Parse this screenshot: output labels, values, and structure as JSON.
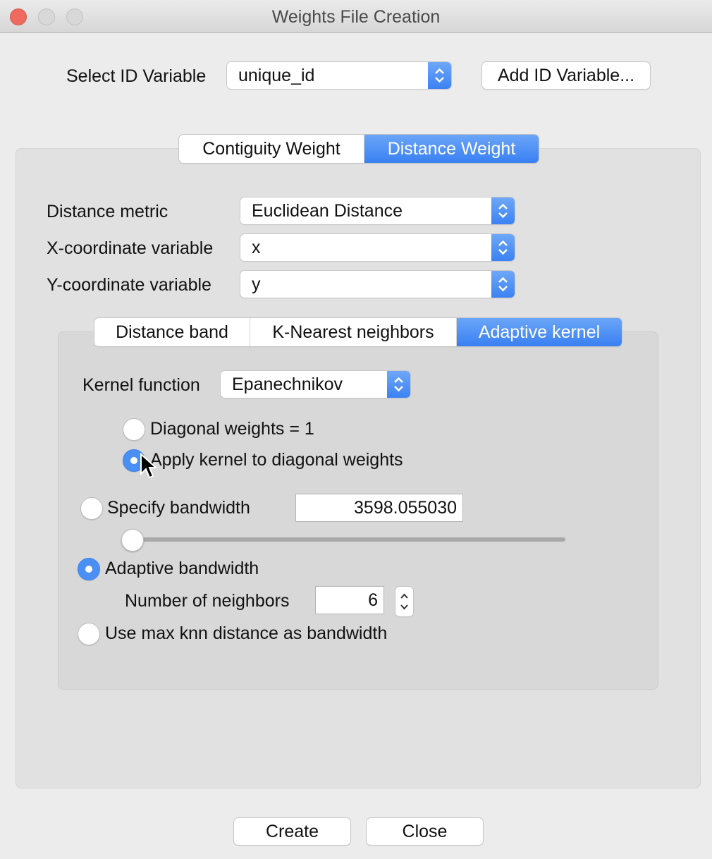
{
  "window": {
    "title": "Weights File Creation"
  },
  "id_section": {
    "label": "Select ID Variable",
    "selected": "unique_id",
    "add_button": "Add ID Variable..."
  },
  "weight_tabs": [
    {
      "label": "Contiguity Weight",
      "active": false
    },
    {
      "label": "Distance Weight",
      "active": true
    }
  ],
  "distance": {
    "metric_label": "Distance metric",
    "metric_value": "Euclidean Distance",
    "x_label": "X-coordinate variable",
    "x_value": "x",
    "y_label": "Y-coordinate variable",
    "y_value": "y"
  },
  "method_tabs": [
    {
      "label": "Distance band",
      "active": false
    },
    {
      "label": "K-Nearest neighbors",
      "active": false
    },
    {
      "label": "Adaptive kernel",
      "active": true
    }
  ],
  "kernel": {
    "function_label": "Kernel function",
    "function_value": "Epanechnikov",
    "diagonal_options": [
      {
        "label": "Diagonal weights = 1",
        "selected": false
      },
      {
        "label": "Apply kernel to diagonal weights",
        "selected": true
      }
    ],
    "specify_bandwidth": {
      "label": "Specify bandwidth",
      "selected": false,
      "value": "3598.055030",
      "slider_fraction": 0.0
    },
    "adaptive_bandwidth": {
      "label": "Adaptive bandwidth",
      "selected": true
    },
    "neighbors": {
      "label": "Number of neighbors",
      "value": "6"
    },
    "max_knn": {
      "label": "Use max knn distance as bandwidth",
      "selected": false
    }
  },
  "footer": {
    "create": "Create",
    "close": "Close"
  },
  "colors": {
    "accent": "#3b82f4",
    "close_light": "#ee6a5e"
  }
}
